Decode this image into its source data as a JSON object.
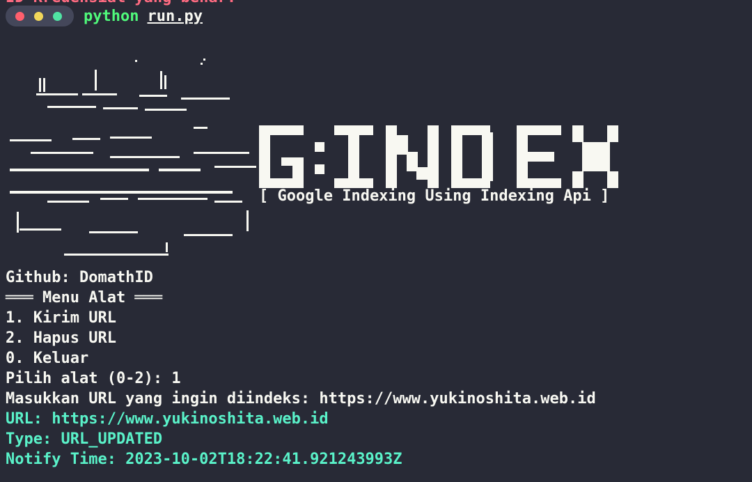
{
  "top_text": "ID Kredensial yang benar.",
  "window_dots": {
    "red": "#ff5f6d",
    "yellow": "#f1d65a",
    "green": "#50e3a4"
  },
  "command": {
    "program": "python",
    "file": "run.py"
  },
  "logo": {
    "title": "G:INDEX",
    "tagline": "[ Google Indexing Using Indexing Api ]"
  },
  "output": {
    "github": "Github: DomathID",
    "menu_header": "═══ Menu Alat ═══",
    "option1": "1. Kirim URL",
    "option2": "2. Hapus URL",
    "option0": "0. Keluar",
    "choose": "Pilih alat (0-2): 1",
    "input_url": "Masukkan URL yang ingin diindeks: https://www.yukinoshita.web.id",
    "result_url": "URL: https://www.yukinoshita.web.id",
    "result_type": "Type: URL_UPDATED",
    "result_time": "Notify Time: 2023-10-02T18:22:41.921243993Z"
  }
}
